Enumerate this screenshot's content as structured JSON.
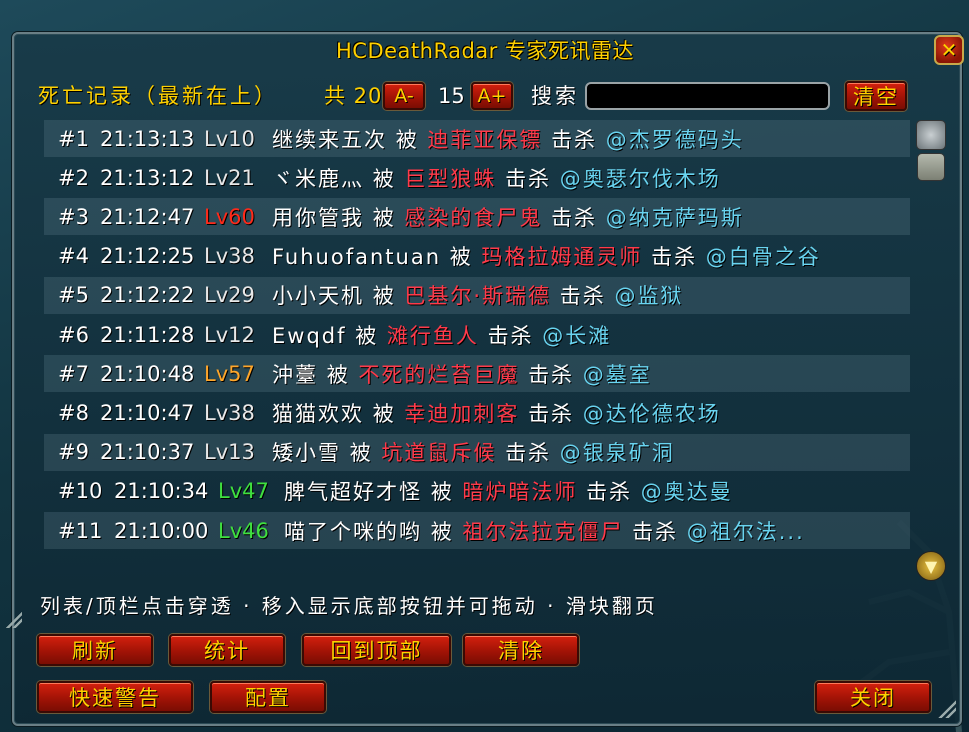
{
  "window": {
    "title": "HCDeathRadar 专家死讯雷达",
    "close_glyph": "✕"
  },
  "toolbar": {
    "section_label": "死亡记录（最新在上）",
    "count_label": "共 20",
    "font_decrease": "A-",
    "font_size": "15",
    "font_increase": "A+",
    "search_label": "搜索",
    "search_value": "",
    "clear_label": "清空"
  },
  "connectors": {
    "killed_by": "被",
    "killed": "击杀"
  },
  "records": [
    {
      "num": "#1",
      "time": "21:13:13",
      "level": "Lv10",
      "level_color": "gray",
      "player": "继续来五次",
      "killer": "迪菲亚保镖",
      "location": "@杰罗德码头"
    },
    {
      "num": "#2",
      "time": "21:13:12",
      "level": "Lv21",
      "level_color": "gray",
      "player": "ヾ米鹿灬",
      "killer": "巨型狼蛛",
      "location": "@奥瑟尔伐木场"
    },
    {
      "num": "#3",
      "time": "21:12:47",
      "level": "Lv60",
      "level_color": "red",
      "player": "用你管我",
      "killer": "感染的食尸鬼",
      "location": "@纳克萨玛斯"
    },
    {
      "num": "#4",
      "time": "21:12:25",
      "level": "Lv38",
      "level_color": "gray",
      "player": "Fuhuofantuan",
      "killer": "玛格拉姆通灵师",
      "location": "@白骨之谷"
    },
    {
      "num": "#5",
      "time": "21:12:22",
      "level": "Lv29",
      "level_color": "gray",
      "player": "小小天机",
      "killer": "巴基尔·斯瑞德",
      "location": "@监狱"
    },
    {
      "num": "#6",
      "time": "21:11:28",
      "level": "Lv12",
      "level_color": "gray",
      "player": "Ewqdf",
      "killer": "滩行鱼人",
      "location": "@长滩"
    },
    {
      "num": "#7",
      "time": "21:10:48",
      "level": "Lv57",
      "level_color": "orange",
      "player": "沖薹",
      "killer": "不死的烂苔巨魔",
      "location": "@墓室"
    },
    {
      "num": "#8",
      "time": "21:10:47",
      "level": "Lv38",
      "level_color": "gray",
      "player": "猫猫欢欢",
      "killer": "幸迪加刺客",
      "location": "@达伦德农场"
    },
    {
      "num": "#9",
      "time": "21:10:37",
      "level": "Lv13",
      "level_color": "gray",
      "player": "矮小雪",
      "killer": "坑道鼠斥候",
      "location": "@银泉矿洞"
    },
    {
      "num": "#10",
      "time": "21:10:34",
      "level": "Lv47",
      "level_color": "green",
      "player": "脾气超好才怪",
      "killer": "暗炉暗法师",
      "location": "@奥达曼"
    },
    {
      "num": "#11",
      "time": "21:10:00",
      "level": "Lv46",
      "level_color": "green",
      "player": "喵了个咪的哟",
      "killer": "祖尔法拉克僵尸",
      "location": "@祖尔法..."
    }
  ],
  "hint": "列表/顶栏点击穿透 · 移入显示底部按钮并可拖动 · 滑块翻页",
  "buttons": {
    "refresh": "刷新",
    "stats": "统计",
    "to_top": "回到顶部",
    "clear": "清除",
    "quick_alert": "快速警告",
    "config": "配置",
    "close": "关闭"
  },
  "colors": {
    "title": "#ffd100",
    "killer": "#ff3a4a",
    "location": "#69d4f0",
    "lv_red": "#ff2a1a",
    "lv_orange": "#ffa62a",
    "lv_green": "#3fe03f"
  },
  "icons": {
    "scroll_up": "scroll-up-icon",
    "scroll_down": "scroll-down-icon",
    "close": "close-icon"
  }
}
